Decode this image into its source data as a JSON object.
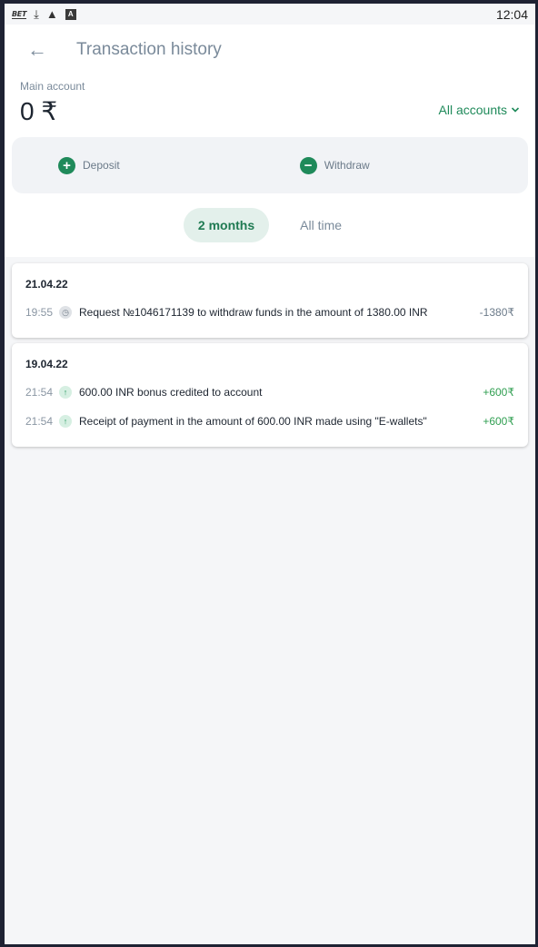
{
  "statusbar": {
    "time": "12:04",
    "icons": [
      "bet-logo-icon",
      "download-icon",
      "warning-icon",
      "a-box-icon"
    ],
    "bet_text": "BET"
  },
  "header": {
    "title": "Transaction history",
    "back_icon": "arrow-left-icon"
  },
  "account": {
    "label": "Main account",
    "balance": "0 ₹",
    "switch_label": "All accounts"
  },
  "actions": {
    "deposit_label": "Deposit",
    "withdraw_label": "Withdraw"
  },
  "filters": [
    {
      "label": "2 months",
      "active": true
    },
    {
      "label": "All time",
      "active": false
    }
  ],
  "groups": [
    {
      "date": "21.04.22",
      "transactions": [
        {
          "time": "19:55",
          "icon": "clock-icon",
          "description": "Request №1046171139 to withdraw funds in the amount of 1380.00 INR",
          "amount": "-1380₹"
        }
      ]
    },
    {
      "date": "19.04.22",
      "transactions": [
        {
          "time": "21:54",
          "icon": "arrow-up-icon",
          "description": "600.00 INR bonus credited to account",
          "amount": "+600₹"
        },
        {
          "time": "21:54",
          "icon": "arrow-up-icon",
          "description": "Receipt of payment in the amount of 600.00 INR made using \"E-wallets\"",
          "amount": "+600₹"
        }
      ]
    }
  ],
  "colors": {
    "accent": "#1f8a5a",
    "positive": "#2f9e50",
    "muted": "#7a8a9a"
  }
}
